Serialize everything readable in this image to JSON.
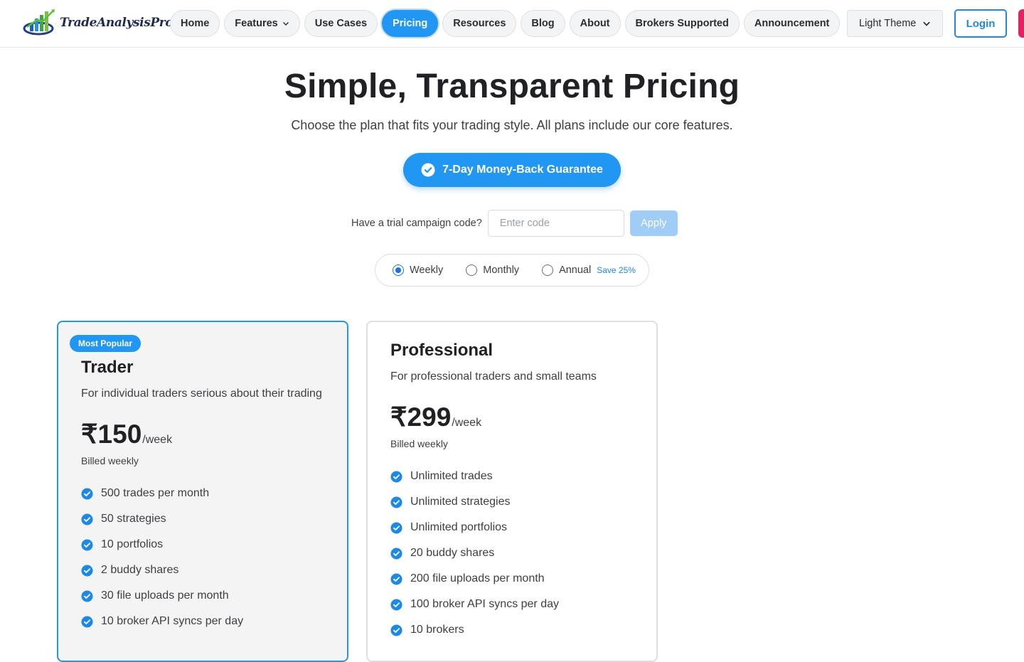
{
  "brand": {
    "name": "TradeAnalysisPro"
  },
  "nav": {
    "items": [
      {
        "label": "Home"
      },
      {
        "label": "Features",
        "has_dropdown": true
      },
      {
        "label": "Use Cases"
      },
      {
        "label": "Pricing",
        "active": true
      },
      {
        "label": "Resources"
      },
      {
        "label": "Blog"
      },
      {
        "label": "About"
      },
      {
        "label": "Brokers Supported"
      },
      {
        "label": "Announcement"
      }
    ],
    "theme_select": "Light Theme",
    "login_label": "Login"
  },
  "hero": {
    "title": "Simple, Transparent Pricing",
    "subtitle": "Choose the plan that fits your trading style. All plans include our core features.",
    "guarantee_label": "7-Day Money-Back Guarantee"
  },
  "promo": {
    "label": "Have a trial campaign code?",
    "placeholder": "Enter code",
    "value": "",
    "apply_label": "Apply"
  },
  "billing": {
    "options": [
      {
        "label": "Weekly",
        "checked": true
      },
      {
        "label": "Monthly",
        "checked": false
      },
      {
        "label": "Annual",
        "checked": false,
        "tag": "Save 25%"
      }
    ]
  },
  "plans": [
    {
      "badge": "Most Popular",
      "name": "Trader",
      "description": "For individual traders serious about their trading",
      "price": "₹150",
      "period": "/week",
      "billed": "Billed weekly",
      "features": [
        "500 trades per month",
        "50 strategies",
        "10 portfolios",
        "2 buddy shares",
        "30 file uploads per month",
        "10 broker API syncs per day"
      ]
    },
    {
      "name": "Professional",
      "description": "For professional traders and small teams",
      "price": "₹299",
      "period": "/week",
      "billed": "Billed weekly",
      "features": [
        "Unlimited trades",
        "Unlimited strategies",
        "Unlimited portfolios",
        "20 buddy shares",
        "200 file uploads per month",
        "100 broker API syncs per day",
        "10 brokers"
      ]
    }
  ],
  "colors": {
    "accent": "#2196f3",
    "login": "#1e88e5",
    "signup": "#e91e63",
    "check": "#1e88e5"
  }
}
